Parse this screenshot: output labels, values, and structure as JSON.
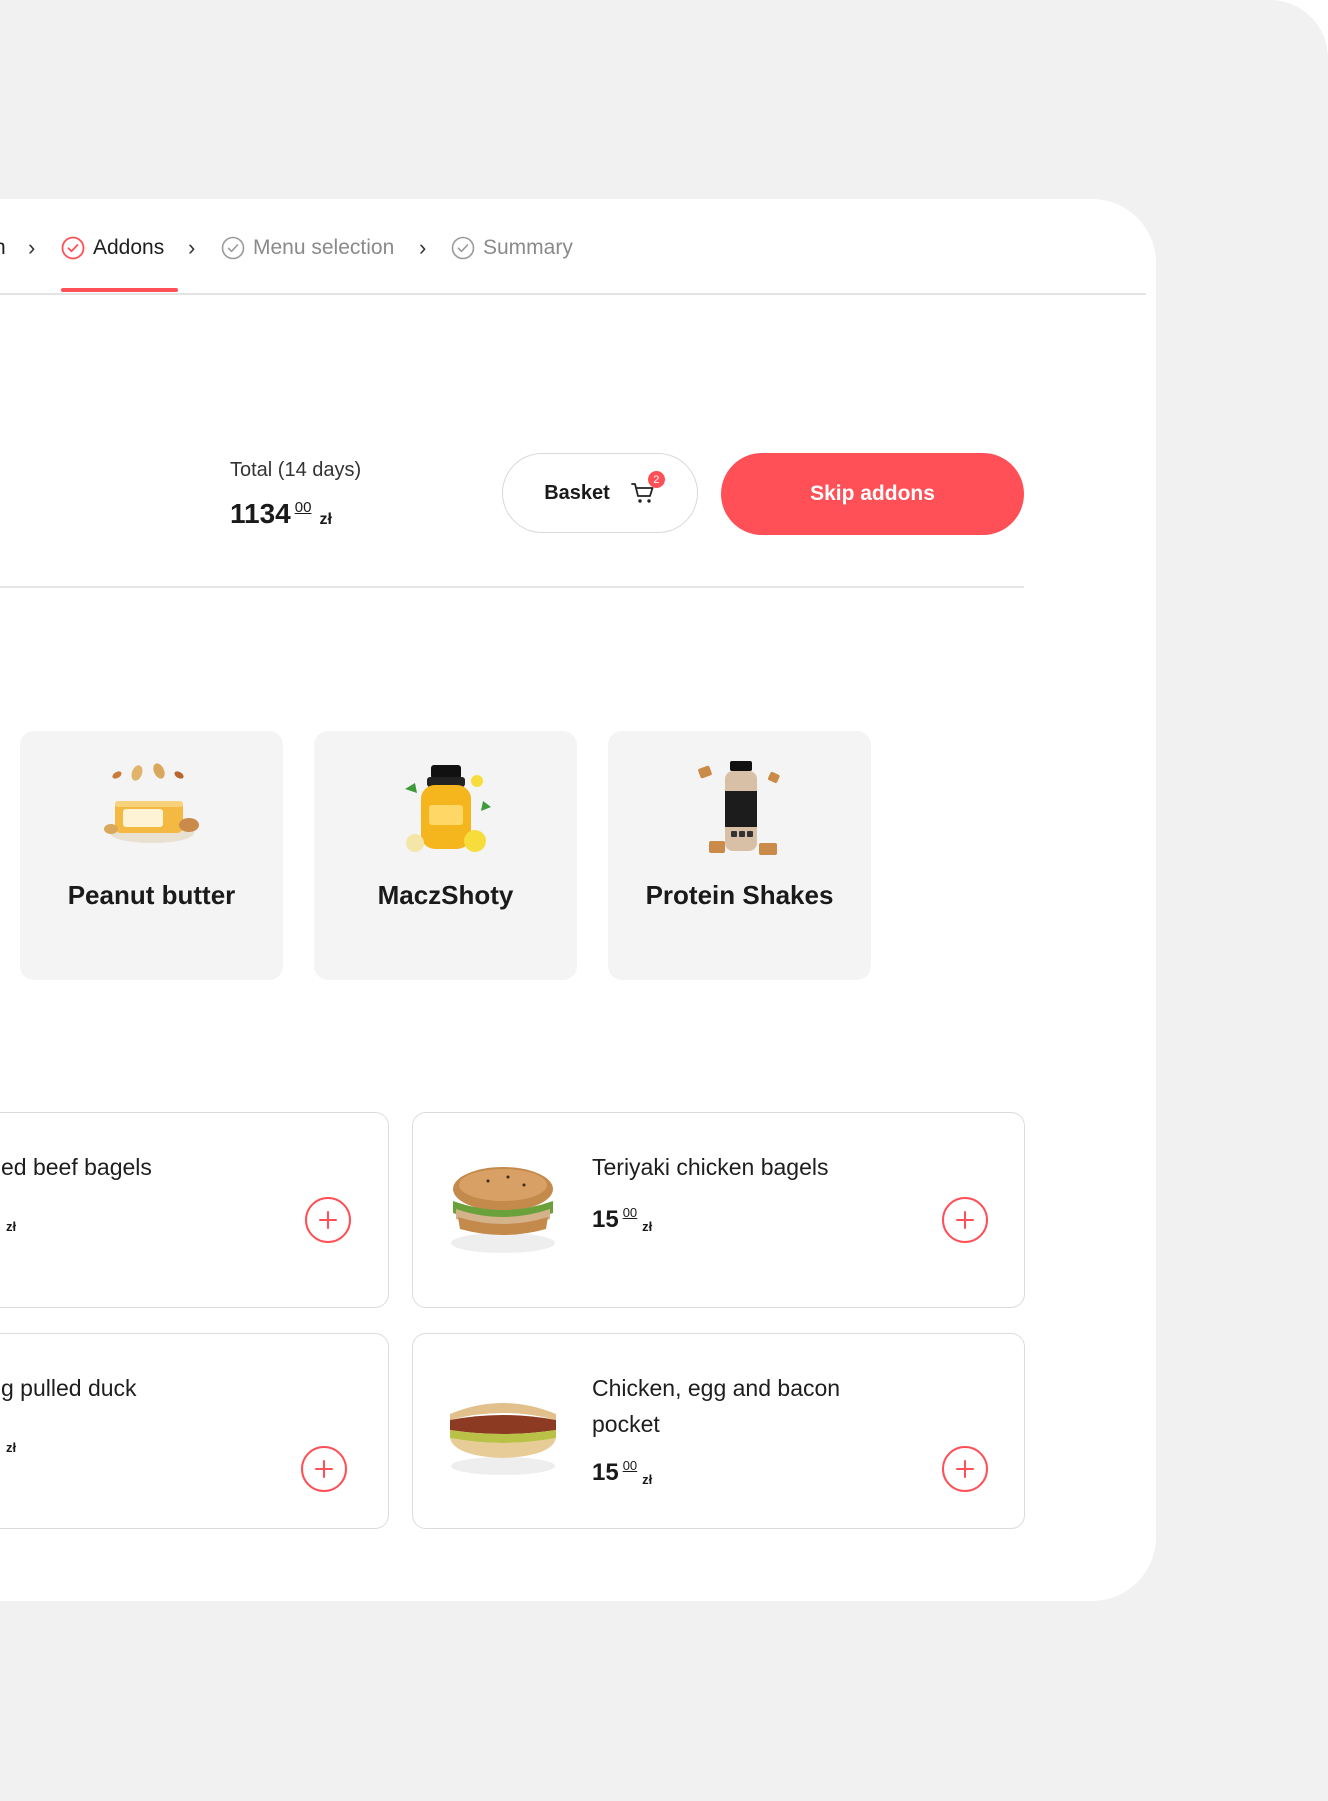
{
  "stepper": {
    "steps": [
      {
        "label": "n",
        "state": "done"
      },
      {
        "label": "Addons",
        "state": "active"
      },
      {
        "label": "Menu selection",
        "state": "pending"
      },
      {
        "label": "Summary",
        "state": "pending"
      }
    ]
  },
  "total": {
    "label": "Total (14 days)",
    "amount_int": "1134",
    "amount_dec": "00",
    "currency": "zł"
  },
  "basket": {
    "label": "Basket",
    "count": "2"
  },
  "skip": {
    "label": "Skip addons"
  },
  "categories": [
    {
      "name": "Peanut butter",
      "icon": "peanut-butter-jar-icon"
    },
    {
      "name": "MaczShoty",
      "icon": "juice-shot-bottle-icon"
    },
    {
      "name": "Protein Shakes",
      "icon": "protein-shake-bottle-icon"
    }
  ],
  "products": [
    {
      "name": "ed beef bagels",
      "price_int": "",
      "price_dec": "",
      "currency": "zł"
    },
    {
      "name": "Teriyaki chicken bagels",
      "price_int": "15",
      "price_dec": "00",
      "currency": "zł"
    },
    {
      "name": "g pulled duck",
      "price_int": "",
      "price_dec": "",
      "currency": "zł"
    },
    {
      "name": "Chicken, egg and bacon pocket",
      "price_int": "15",
      "price_dec": "00",
      "currency": "zł"
    }
  ],
  "colors": {
    "accent": "#ff4f57",
    "frame": "#f1f1f1",
    "tile": "#f4f4f4"
  }
}
